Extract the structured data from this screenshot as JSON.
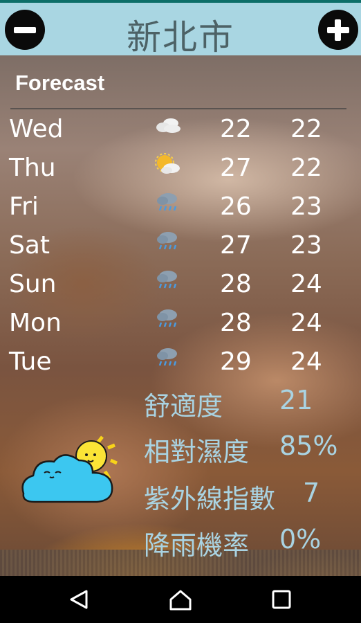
{
  "header": {
    "city": "新北市",
    "minus_icon": "remove-circle-icon",
    "plus_icon": "add-circle-icon",
    "bar_color": "#a9d6e2"
  },
  "forecast": {
    "label": "Forecast",
    "days": [
      {
        "day": "Wed",
        "icon": "cloudy-icon",
        "hi": "22",
        "lo": "22"
      },
      {
        "day": "Thu",
        "icon": "partly-sunny-icon",
        "hi": "27",
        "lo": "22"
      },
      {
        "day": "Fri",
        "icon": "rain-icon",
        "hi": "26",
        "lo": "23"
      },
      {
        "day": "Sat",
        "icon": "rain-icon",
        "hi": "27",
        "lo": "23"
      },
      {
        "day": "Sun",
        "icon": "rain-icon",
        "hi": "28",
        "lo": "24"
      },
      {
        "day": "Mon",
        "icon": "rain-icon",
        "hi": "28",
        "lo": "24"
      },
      {
        "day": "Tue",
        "icon": "rain-icon",
        "hi": "29",
        "lo": "24"
      }
    ]
  },
  "stats": [
    {
      "label": "舒適度",
      "value": "21"
    },
    {
      "label": "相對濕度",
      "value": "85%"
    },
    {
      "label": "紫外線指數",
      "value": "7"
    },
    {
      "label": "降雨機率",
      "value": "0%"
    }
  ],
  "mascot": "sun-and-cloud-mascot-icon",
  "navbar": {
    "back": "back-triangle-icon",
    "home": "home-icon",
    "recents": "recents-square-icon"
  }
}
